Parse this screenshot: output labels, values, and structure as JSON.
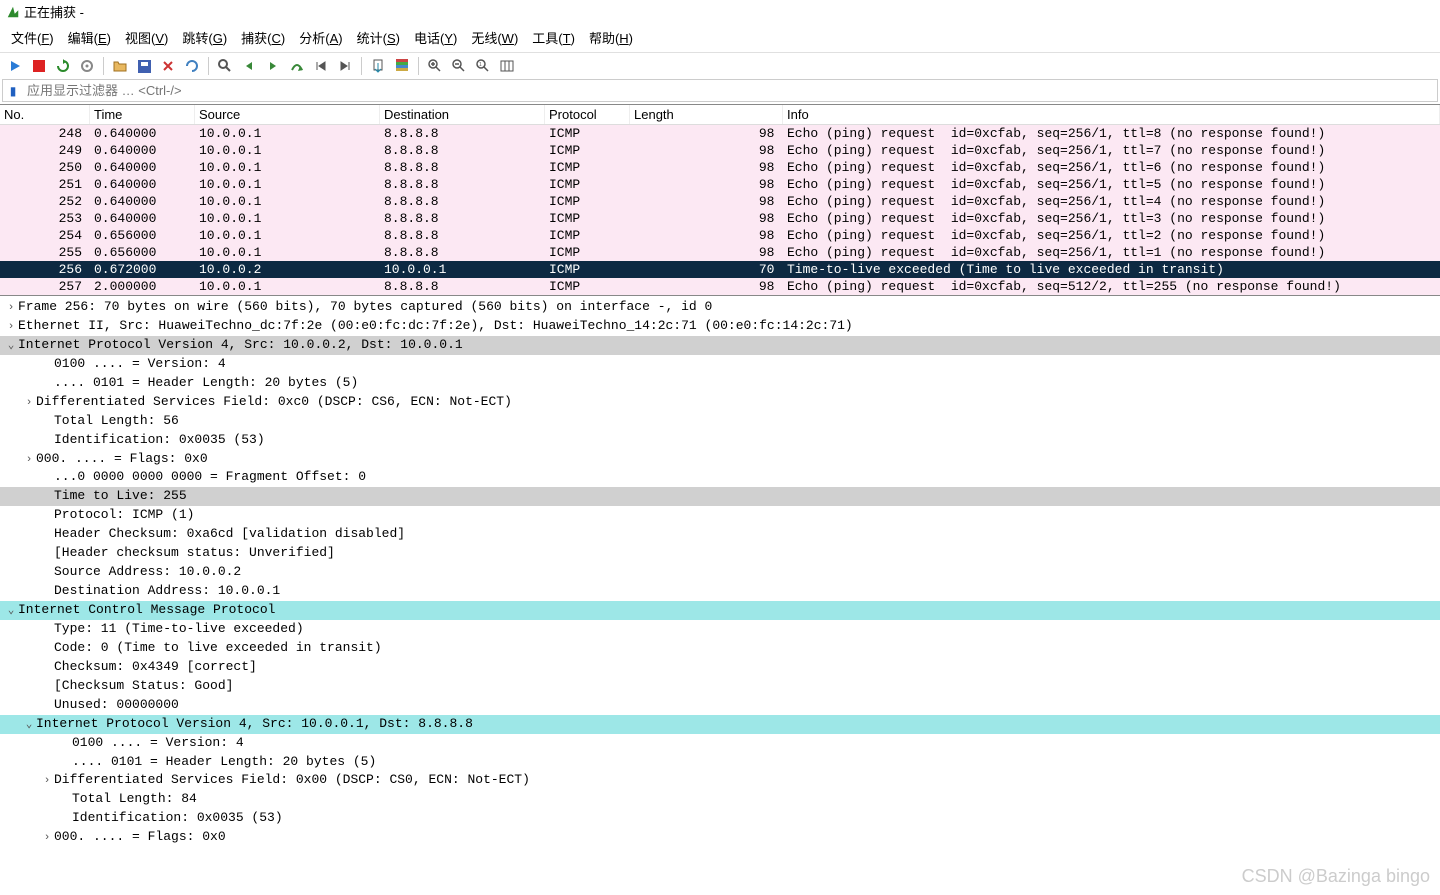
{
  "window": {
    "title": "正在捕获 -",
    "icon_color": "#2d8a2d"
  },
  "menu": [
    {
      "label": "文件",
      "key": "F"
    },
    {
      "label": "编辑",
      "key": "E"
    },
    {
      "label": "视图",
      "key": "V"
    },
    {
      "label": "跳转",
      "key": "G"
    },
    {
      "label": "捕获",
      "key": "C"
    },
    {
      "label": "分析",
      "key": "A"
    },
    {
      "label": "统计",
      "key": "S"
    },
    {
      "label": "电话",
      "key": "Y"
    },
    {
      "label": "无线",
      "key": "W"
    },
    {
      "label": "工具",
      "key": "T"
    },
    {
      "label": "帮助",
      "key": "H"
    }
  ],
  "filter": {
    "placeholder": "应用显示过滤器 … <Ctrl-/>"
  },
  "columns": {
    "no": "No.",
    "time": "Time",
    "src": "Source",
    "dst": "Destination",
    "proto": "Protocol",
    "len": "Length",
    "info": "Info"
  },
  "packets": [
    {
      "no": "248",
      "time": "0.640000",
      "src": "10.0.0.1",
      "dst": "8.8.8.8",
      "proto": "ICMP",
      "len": "98",
      "info": "Echo (ping) request  id=0xcfab, seq=256/1, ttl=8 (no response found!)",
      "cls": "row-pink"
    },
    {
      "no": "249",
      "time": "0.640000",
      "src": "10.0.0.1",
      "dst": "8.8.8.8",
      "proto": "ICMP",
      "len": "98",
      "info": "Echo (ping) request  id=0xcfab, seq=256/1, ttl=7 (no response found!)",
      "cls": "row-pink"
    },
    {
      "no": "250",
      "time": "0.640000",
      "src": "10.0.0.1",
      "dst": "8.8.8.8",
      "proto": "ICMP",
      "len": "98",
      "info": "Echo (ping) request  id=0xcfab, seq=256/1, ttl=6 (no response found!)",
      "cls": "row-pink"
    },
    {
      "no": "251",
      "time": "0.640000",
      "src": "10.0.0.1",
      "dst": "8.8.8.8",
      "proto": "ICMP",
      "len": "98",
      "info": "Echo (ping) request  id=0xcfab, seq=256/1, ttl=5 (no response found!)",
      "cls": "row-pink"
    },
    {
      "no": "252",
      "time": "0.640000",
      "src": "10.0.0.1",
      "dst": "8.8.8.8",
      "proto": "ICMP",
      "len": "98",
      "info": "Echo (ping) request  id=0xcfab, seq=256/1, ttl=4 (no response found!)",
      "cls": "row-pink"
    },
    {
      "no": "253",
      "time": "0.640000",
      "src": "10.0.0.1",
      "dst": "8.8.8.8",
      "proto": "ICMP",
      "len": "98",
      "info": "Echo (ping) request  id=0xcfab, seq=256/1, ttl=3 (no response found!)",
      "cls": "row-pink"
    },
    {
      "no": "254",
      "time": "0.656000",
      "src": "10.0.0.1",
      "dst": "8.8.8.8",
      "proto": "ICMP",
      "len": "98",
      "info": "Echo (ping) request  id=0xcfab, seq=256/1, ttl=2 (no response found!)",
      "cls": "row-pink"
    },
    {
      "no": "255",
      "time": "0.656000",
      "src": "10.0.0.1",
      "dst": "8.8.8.8",
      "proto": "ICMP",
      "len": "98",
      "info": "Echo (ping) request  id=0xcfab, seq=256/1, ttl=1 (no response found!)",
      "cls": "row-pink"
    },
    {
      "no": "256",
      "time": "0.672000",
      "src": "10.0.0.2",
      "dst": "10.0.0.1",
      "proto": "ICMP",
      "len": "70",
      "info": "Time-to-live exceeded (Time to live exceeded in transit)",
      "cls": "row-selected"
    },
    {
      "no": "257",
      "time": "2.000000",
      "src": "10.0.0.1",
      "dst": "8.8.8.8",
      "proto": "ICMP",
      "len": "98",
      "info": "Echo (ping) request  id=0xcfab, seq=512/2, ttl=255 (no response found!)",
      "cls": "row-pink"
    }
  ],
  "tree": [
    {
      "t": "Frame 256: 70 bytes on wire (560 bits), 70 bytes captured (560 bits) on interface -, id 0",
      "ind": 0,
      "exp": ">",
      "hl": ""
    },
    {
      "t": "Ethernet II, Src: HuaweiTechno_dc:7f:2e (00:e0:fc:dc:7f:2e), Dst: HuaweiTechno_14:2c:71 (00:e0:fc:14:2c:71)",
      "ind": 0,
      "exp": ">",
      "hl": ""
    },
    {
      "t": "Internet Protocol Version 4, Src: 10.0.0.2, Dst: 10.0.0.1",
      "ind": 0,
      "exp": "v",
      "hl": "grey"
    },
    {
      "t": "0100 .... = Version: 4",
      "ind": 2,
      "exp": "",
      "hl": ""
    },
    {
      "t": ".... 0101 = Header Length: 20 bytes (5)",
      "ind": 2,
      "exp": "",
      "hl": ""
    },
    {
      "t": "Differentiated Services Field: 0xc0 (DSCP: CS6, ECN: Not-ECT)",
      "ind": 1,
      "exp": ">",
      "hl": ""
    },
    {
      "t": "Total Length: 56",
      "ind": 2,
      "exp": "",
      "hl": ""
    },
    {
      "t": "Identification: 0x0035 (53)",
      "ind": 2,
      "exp": "",
      "hl": ""
    },
    {
      "t": "000. .... = Flags: 0x0",
      "ind": 1,
      "exp": ">",
      "hl": ""
    },
    {
      "t": "...0 0000 0000 0000 = Fragment Offset: 0",
      "ind": 2,
      "exp": "",
      "hl": ""
    },
    {
      "t": "Time to Live: 255",
      "ind": 2,
      "exp": "",
      "hl": "grey"
    },
    {
      "t": "Protocol: ICMP (1)",
      "ind": 2,
      "exp": "",
      "hl": ""
    },
    {
      "t": "Header Checksum: 0xa6cd [validation disabled]",
      "ind": 2,
      "exp": "",
      "hl": ""
    },
    {
      "t": "[Header checksum status: Unverified]",
      "ind": 2,
      "exp": "",
      "hl": ""
    },
    {
      "t": "Source Address: 10.0.0.2",
      "ind": 2,
      "exp": "",
      "hl": ""
    },
    {
      "t": "Destination Address: 10.0.0.1",
      "ind": 2,
      "exp": "",
      "hl": ""
    },
    {
      "t": "Internet Control Message Protocol",
      "ind": 0,
      "exp": "v",
      "hl": "cyan"
    },
    {
      "t": "Type: 11 (Time-to-live exceeded)",
      "ind": 2,
      "exp": "",
      "hl": ""
    },
    {
      "t": "Code: 0 (Time to live exceeded in transit)",
      "ind": 2,
      "exp": "",
      "hl": ""
    },
    {
      "t": "Checksum: 0x4349 [correct]",
      "ind": 2,
      "exp": "",
      "hl": ""
    },
    {
      "t": "[Checksum Status: Good]",
      "ind": 2,
      "exp": "",
      "hl": ""
    },
    {
      "t": "Unused: 00000000",
      "ind": 2,
      "exp": "",
      "hl": ""
    },
    {
      "t": "Internet Protocol Version 4, Src: 10.0.0.1, Dst: 8.8.8.8",
      "ind": 1,
      "exp": "v",
      "hl": "cyan"
    },
    {
      "t": "0100 .... = Version: 4",
      "ind": 3,
      "exp": "",
      "hl": ""
    },
    {
      "t": ".... 0101 = Header Length: 20 bytes (5)",
      "ind": 3,
      "exp": "",
      "hl": ""
    },
    {
      "t": "Differentiated Services Field: 0x00 (DSCP: CS0, ECN: Not-ECT)",
      "ind": 2,
      "exp": ">",
      "hl": ""
    },
    {
      "t": "Total Length: 84",
      "ind": 3,
      "exp": "",
      "hl": ""
    },
    {
      "t": "Identification: 0x0035 (53)",
      "ind": 3,
      "exp": "",
      "hl": ""
    },
    {
      "t": "000. .... = Flags: 0x0",
      "ind": 2,
      "exp": ">",
      "hl": ""
    }
  ],
  "watermark": "CSDN @Bazinga bingo",
  "icons": {
    "start": "◀",
    "stop": "■",
    "restart": "🔄",
    "gear": "⚙",
    "save": "💾",
    "close": "✖",
    "find": "🔍",
    "back": "⬅",
    "fwd": "➡",
    "jump": "↷",
    "first": "⇤",
    "last": "⇥",
    "auto": "📶",
    "color": "🎨",
    "zoomin": "🔍+",
    "zoomout": "🔍-",
    "zoom1": "1:1",
    "resize": "⇲"
  }
}
